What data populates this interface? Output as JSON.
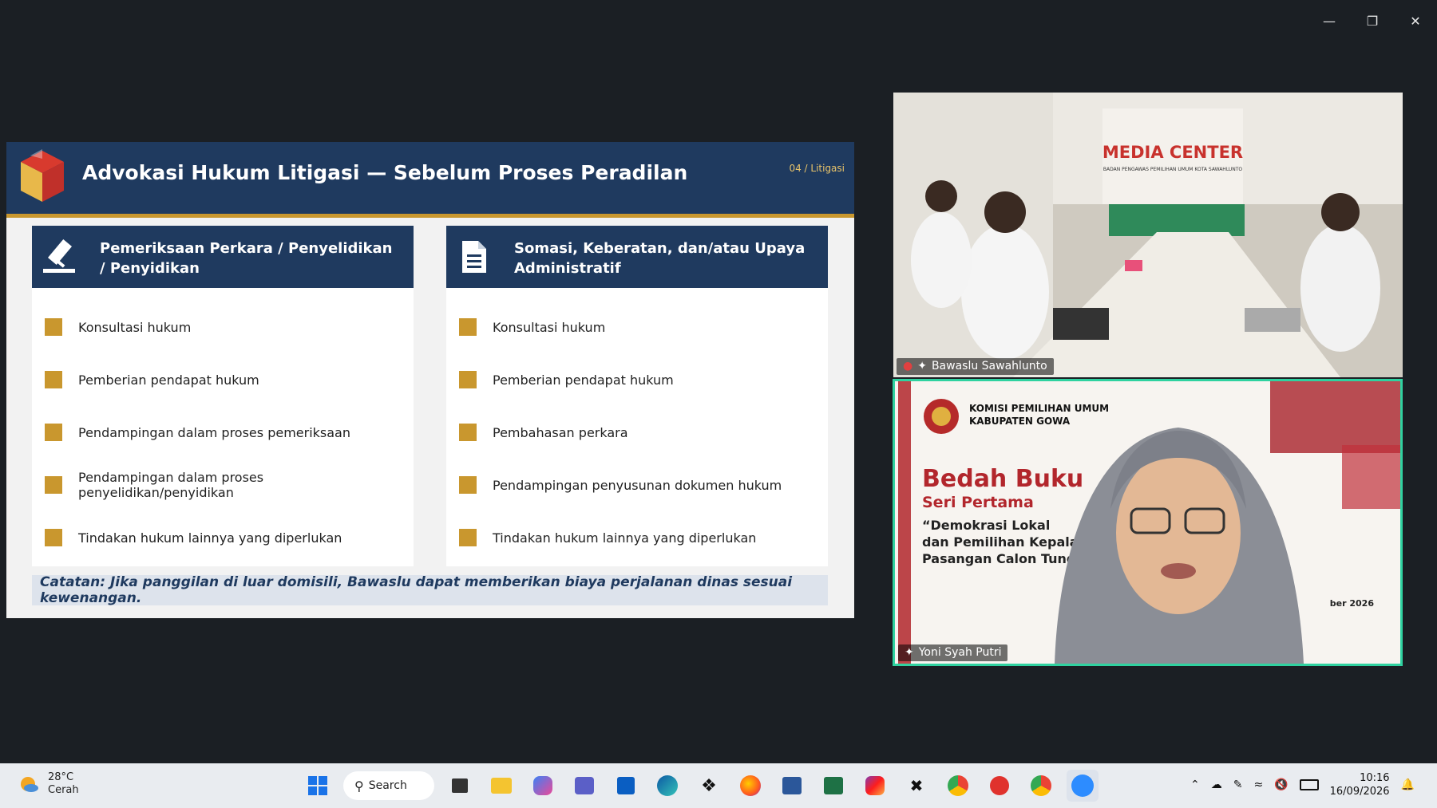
{
  "window": {
    "minimize_icon": "minimize-icon",
    "restore_icon": "restore-icon",
    "close_icon": "close-icon"
  },
  "slide": {
    "title": "Advokasi Hukum Litigasi — Sebelum Proses Peradilan",
    "page_num": "04 / Litigasi",
    "left": {
      "heading": "Pemeriksaan Perkara / Penyelidikan / Penyidikan",
      "icon": "gavel-icon",
      "items": [
        "Konsultasi hukum",
        "Pemberian pendapat hukum",
        "Pendampingan dalam proses pemeriksaan",
        "Pendampingan dalam proses penyelidikan/penyidikan",
        "Tindakan hukum lainnya yang diperlukan"
      ]
    },
    "right": {
      "heading": "Somasi, Keberatan, dan/atau Upaya Administratif",
      "icon": "document-icon",
      "items": [
        "Konsultasi hukum",
        "Pemberian pendapat hukum",
        "Pembahasan perkara",
        "Pendampingan penyusunan dokumen hukum",
        "Tindakan hukum lainnya yang diperlukan"
      ]
    },
    "note": "Catatan: Jika panggilan di luar domisili, Bawaslu dapat memberikan biaya perjalanan dinas sesuai kewenangan.",
    "colors": {
      "navy": "#1f3a5f",
      "gold": "#c9972e"
    }
  },
  "participants": [
    {
      "name": "Bawaslu Sawahlunto",
      "sign": "MEDIA CENTER",
      "sign_sub": "BADAN PENGAWAS PEMILIHAN UMUM KOTA SAWAHLUNTO"
    },
    {
      "name": "Yoni Syah Putri",
      "bg_org_1": "KOMISI PEMILIHAN UMUM",
      "bg_org_2": "KABUPATEN GOWA",
      "bg_title": "Bedah Buku",
      "bg_sub": "Seri Pertama",
      "bg_quote_1": "“Demokrasi Lokal",
      "bg_quote_2": "dan Pemilihan Kepala",
      "bg_quote_3": "Pasangan Calon Tung",
      "bg_date": "ber 2026"
    }
  ],
  "taskbar": {
    "weather_temp": "28°C",
    "weather_desc": "Cerah",
    "search_label": "Search",
    "time": "10:16",
    "date": "16/09/2026"
  }
}
